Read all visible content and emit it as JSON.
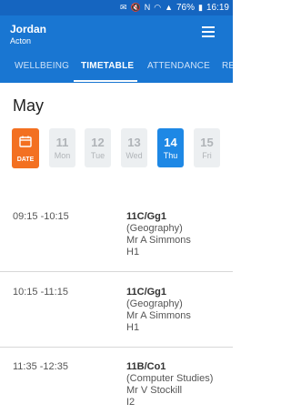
{
  "status_bar": {
    "battery": "76%",
    "time": "16:19"
  },
  "header": {
    "name": "Jordan",
    "subtitle": "Acton"
  },
  "tabs": [
    {
      "label": "WELLBEING"
    },
    {
      "label": "TIMETABLE",
      "active": true
    },
    {
      "label": "ATTENDANCE"
    },
    {
      "label": "RE"
    }
  ],
  "month": "May",
  "date_button": {
    "label": "DATE"
  },
  "days": [
    {
      "num": "11",
      "name": "Mon"
    },
    {
      "num": "12",
      "name": "Tue"
    },
    {
      "num": "13",
      "name": "Wed"
    },
    {
      "num": "14",
      "name": "Thu",
      "selected": true
    },
    {
      "num": "15",
      "name": "Fri"
    }
  ],
  "lessons": [
    {
      "time": "09:15 -10:15",
      "code": "11C/Gg1",
      "subject": "(Geography)",
      "teacher": "Mr A Simmons",
      "room": "H1"
    },
    {
      "time": "10:15 -11:15",
      "code": "11C/Gg1",
      "subject": "(Geography)",
      "teacher": "Mr A Simmons",
      "room": "H1"
    },
    {
      "time": "11:35 -12:35",
      "code": "11B/Co1",
      "subject": "(Computer Studies)",
      "teacher": "Mr V Stockill",
      "room": "I2"
    }
  ],
  "colors": {
    "primary": "#1976d2",
    "accent": "#f37021",
    "selected_day": "#1e88e5"
  }
}
